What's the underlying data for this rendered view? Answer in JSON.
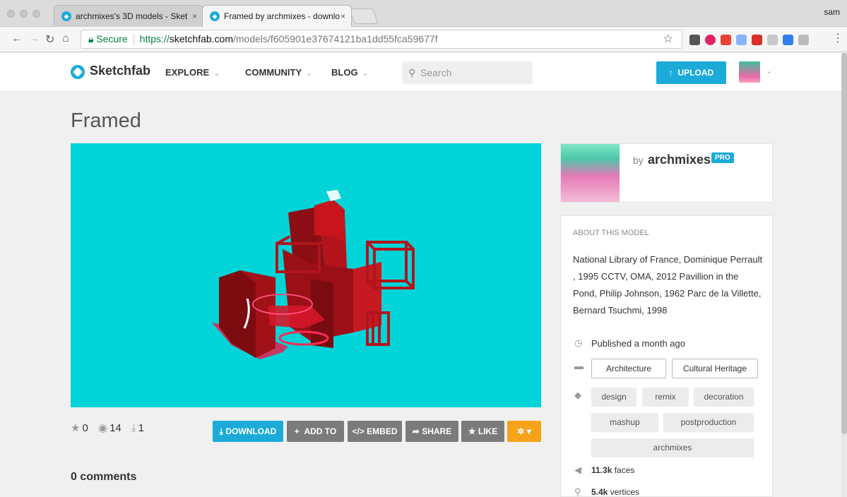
{
  "browser": {
    "tabs": [
      {
        "title": "archmixes's 3D models - Sket",
        "close": "×"
      },
      {
        "title": "Framed by archmixes - downlo",
        "close": "×"
      }
    ],
    "user": "sam",
    "secure_label": "Secure",
    "url_scheme": "https://",
    "url_host": "sketchfab.com",
    "url_path": "/models/f605901e37674121ba1dd55fca59677f"
  },
  "header": {
    "logo": "Sketchfab",
    "nav": [
      "EXPLORE",
      "COMMUNITY",
      "BLOG"
    ],
    "search_placeholder": "Search",
    "upload_label": "UPLOAD"
  },
  "model": {
    "title": "Framed",
    "stats": {
      "likes": "0",
      "views": "14",
      "downloads": "1"
    },
    "buttons": {
      "download": "DOWNLOAD",
      "add_to": "ADD TO",
      "embed": "EMBED",
      "share": "SHARE",
      "like": "LIKE"
    },
    "comments": "0 comments"
  },
  "author": {
    "by": "by",
    "name": "archmixes",
    "badge": "PRO"
  },
  "about": {
    "heading": "ABOUT THIS MODEL",
    "description": "National Library of France, Dominique Perrault , 1995 CCTV, OMA, 2012 Pavillion in the Pond, Philip Johnson, 1962 Parc de la Villette, Bernard Tsuchmi, 1998",
    "published": "Published a month ago",
    "categories": [
      "Architecture",
      "Cultural Heritage"
    ],
    "tags": [
      "design",
      "remix",
      "decoration",
      "mashup",
      "postproduction",
      "archmixes"
    ],
    "faces_value": "11.3k",
    "faces_label": "faces",
    "vertices_value": "5.4k",
    "vertices_label": "vertices"
  },
  "colors": {
    "accent": "#1caad9",
    "viewer_bg": "#00d4d8",
    "model_red": "#b3141c",
    "settings_orange": "#f7a21b"
  }
}
